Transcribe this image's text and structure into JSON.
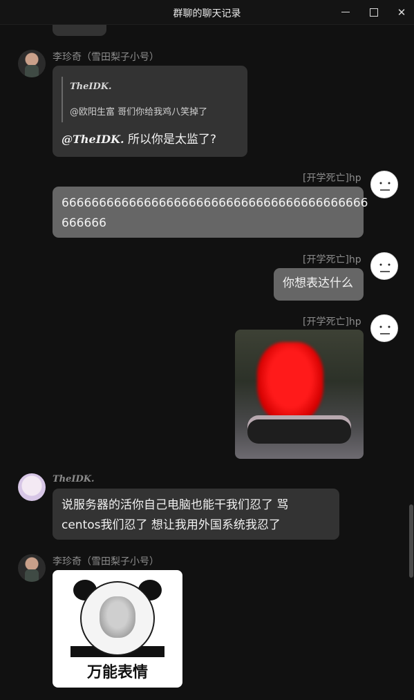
{
  "window": {
    "title": "群聊的聊天记录"
  },
  "messages": {
    "m1_name": "李珍奇（雪田梨子小号）",
    "m1_quote_author": "TheIDK.",
    "m1_quote_text": "@欧阳生富 哥们你给我鸡八笑掉了",
    "m1_mention": "@TheIDK.",
    "m1_text": " 所以你是太监了?",
    "m2_name": "[开学死亡]hp",
    "m2_line1": "66666666666666666666666666666666666666666",
    "m2_line2": "666666",
    "m3_name": "[开学死亡]hp",
    "m3_text": "你想表达什么",
    "m4_name": "[开学死亡]hp",
    "m5_name": "TheIDK.",
    "m5_line1": "说服务器的活你自己电脑也能干我们忍了 骂",
    "m5_line2": "centos我们忍了 想让我用外国系统我忍了",
    "m6_name": "李珍奇（雪田梨子小号）",
    "m6_sticker_caption": "万能表情"
  },
  "icons": {
    "minimize": "minimize-icon",
    "maximize": "maximize-icon",
    "close": "close-icon"
  }
}
